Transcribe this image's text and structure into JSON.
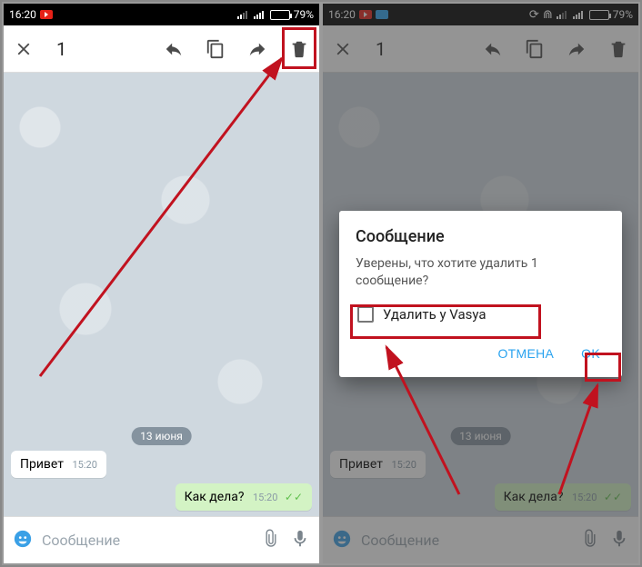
{
  "status": {
    "time": "16:20",
    "battery_pct": "79%"
  },
  "appbar": {
    "selected_count": "1"
  },
  "chat": {
    "date_chip": "13 июня",
    "msg_in": {
      "text": "Привет",
      "time": "15:20"
    },
    "msg_out": {
      "text": "Как дела?",
      "time": "15:20"
    }
  },
  "composer": {
    "placeholder": "Сообщение"
  },
  "dialog": {
    "title": "Сообщение",
    "body": "Уверены, что хотите удалить 1 сообщение?",
    "checkbox_label": "Удалить у Vasya",
    "cancel": "ОТМЕНА",
    "ok": "OK"
  }
}
